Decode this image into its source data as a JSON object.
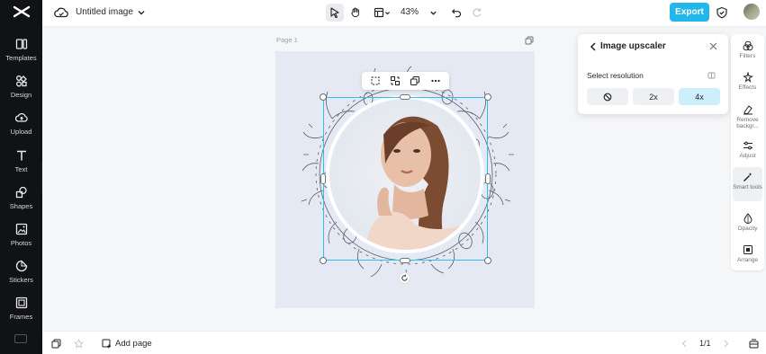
{
  "app": {
    "title": "Untitled image",
    "zoom": "43%",
    "export_label": "Export"
  },
  "rail": {
    "items": [
      {
        "label": "Templates",
        "icon": "templates-icon"
      },
      {
        "label": "Design",
        "icon": "design-icon"
      },
      {
        "label": "Upload",
        "icon": "upload-icon"
      },
      {
        "label": "Text",
        "icon": "text-icon"
      },
      {
        "label": "Shapes",
        "icon": "shapes-icon"
      },
      {
        "label": "Photos",
        "icon": "photos-icon"
      },
      {
        "label": "Stickers",
        "icon": "stickers-icon"
      },
      {
        "label": "Frames",
        "icon": "frames-icon"
      }
    ]
  },
  "canvas": {
    "page_label": "Page 1"
  },
  "upscaler": {
    "title": "Image upscaler",
    "subtitle": "Select resolution",
    "options": [
      "2x",
      "4x"
    ],
    "selected": "4x"
  },
  "right_panel": {
    "items": [
      {
        "label": "Filters"
      },
      {
        "label": "Effects"
      },
      {
        "label": "Remove backgr..."
      },
      {
        "label": "Adjust"
      },
      {
        "label": "Smart tools"
      },
      {
        "label": "Opacity"
      },
      {
        "label": "Arrange"
      }
    ]
  },
  "bottom": {
    "add_page_label": "Add page",
    "pager": "1/1"
  },
  "colors": {
    "accent": "#22b7ea",
    "selection": "#2ec0e6",
    "rail_bg": "#111215",
    "page_bg": "#e5e9f3"
  }
}
